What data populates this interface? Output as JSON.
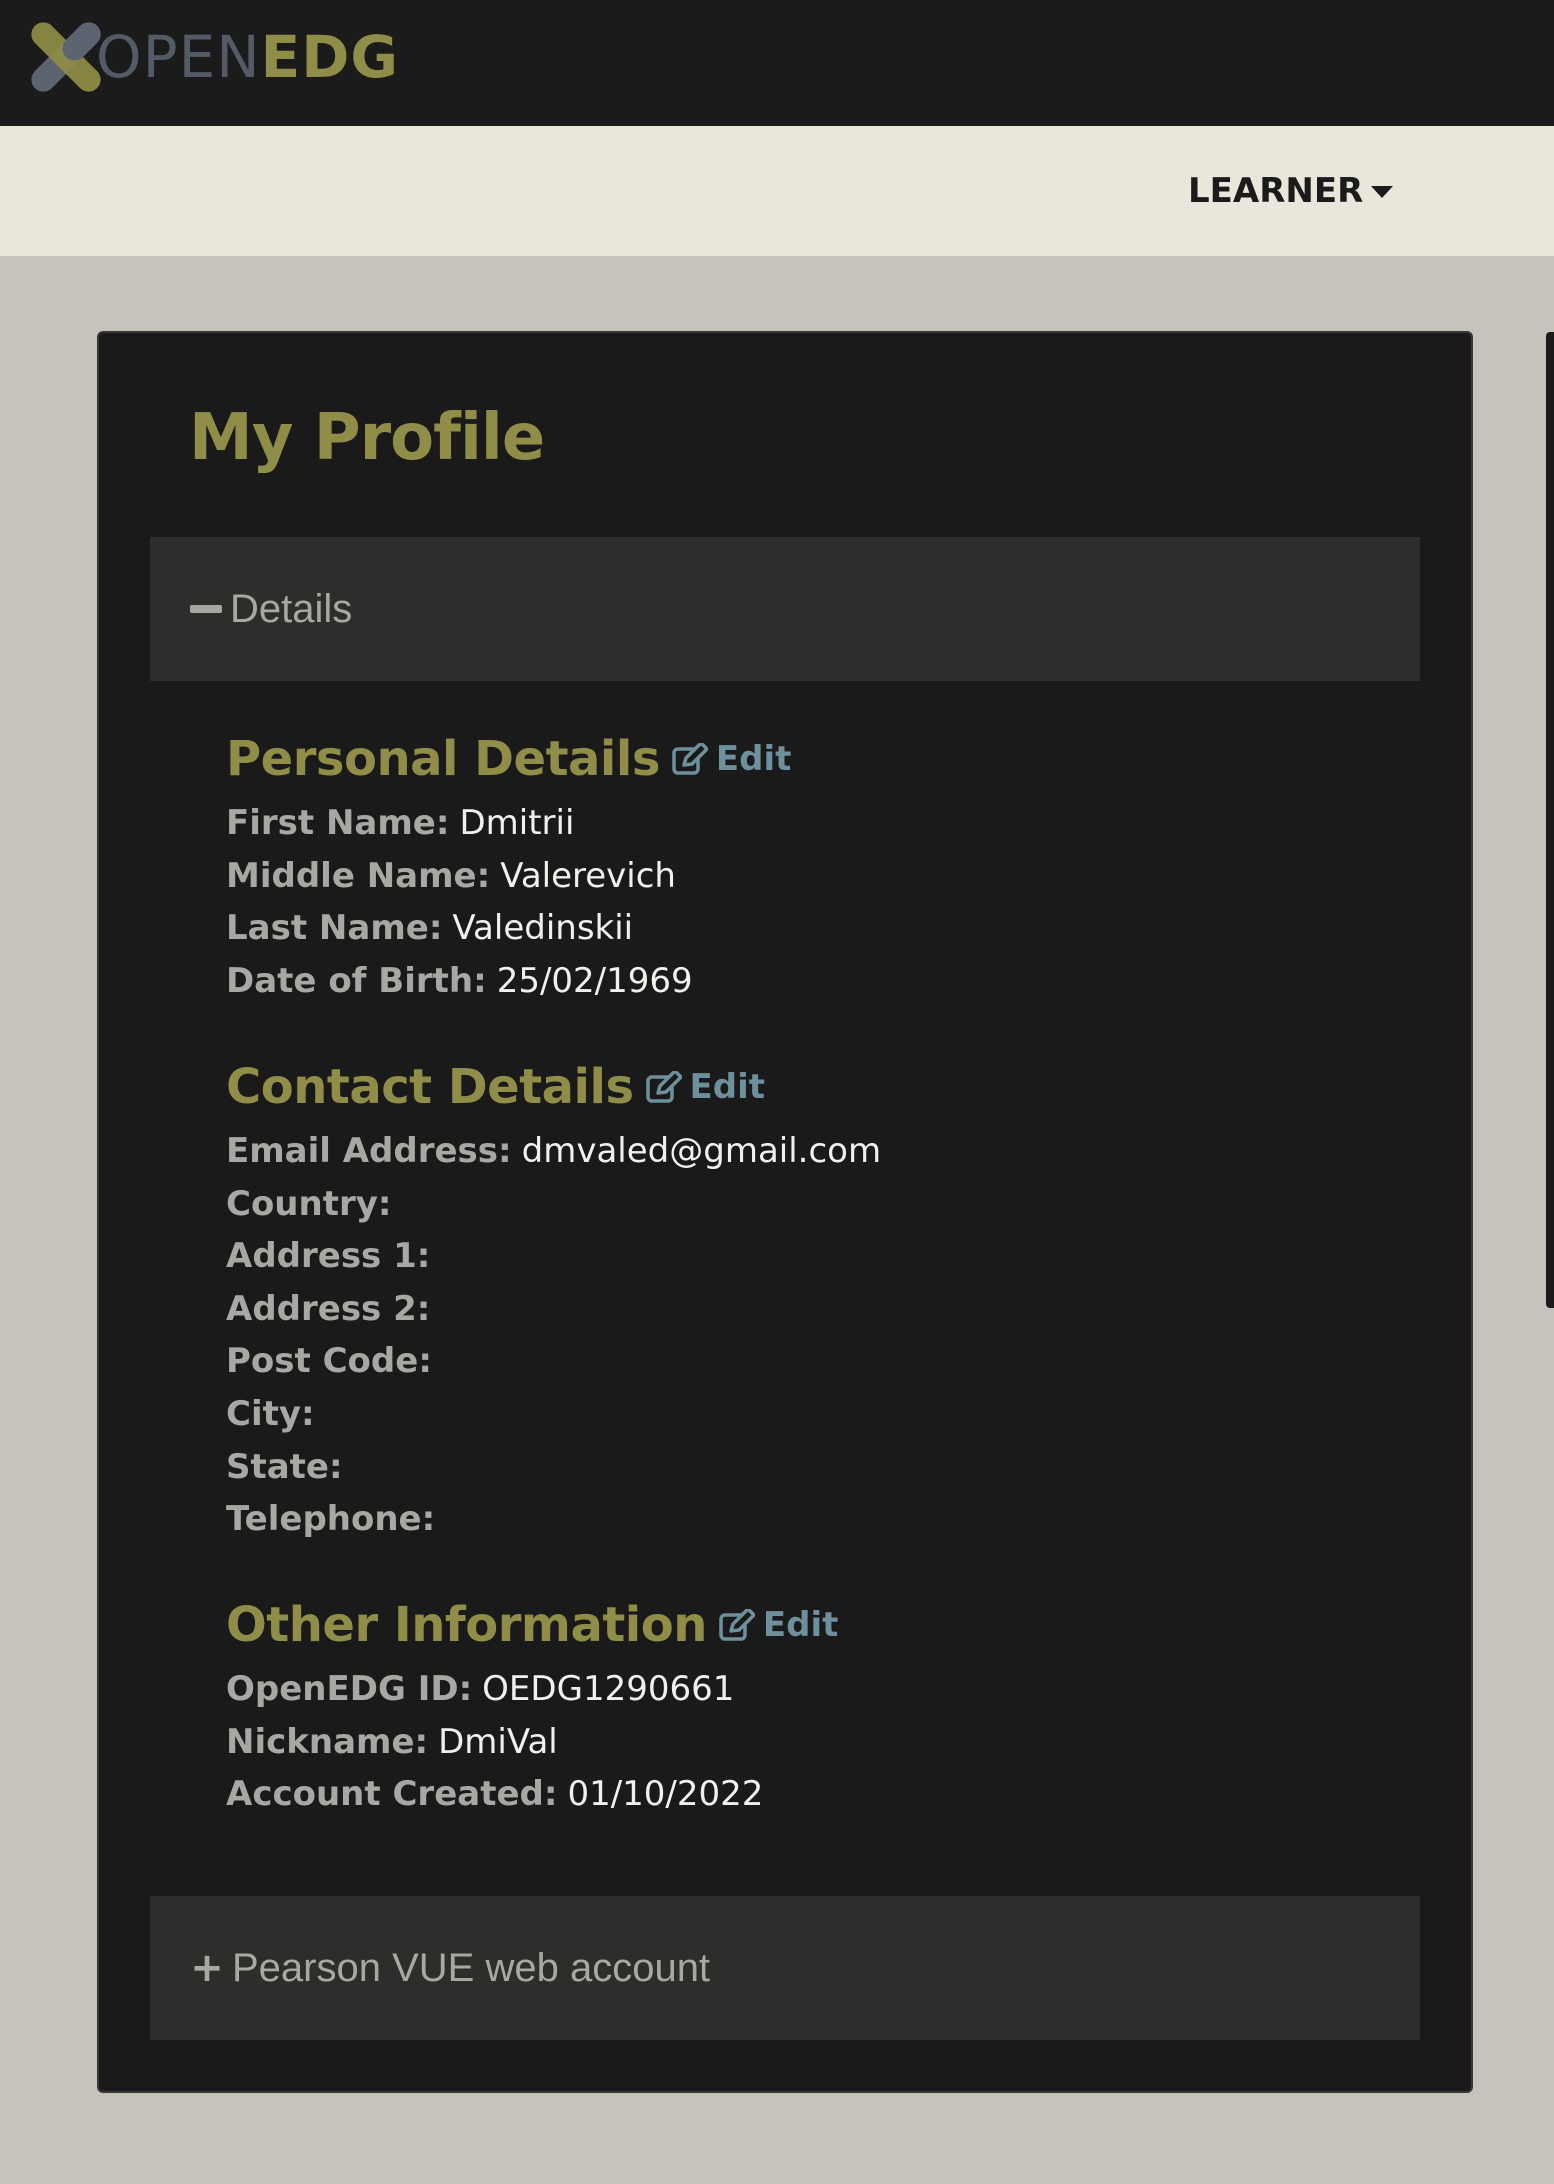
{
  "header": {
    "logo": {
      "word_open": "OPEN",
      "word_edg": "EDG"
    }
  },
  "nav": {
    "learner_label": "LEARNER"
  },
  "colors": {
    "olive": "#8f8d47",
    "link_blue": "#6e8f9c",
    "dark": "#1c1b1b",
    "beige": "#ebe6db"
  },
  "profile": {
    "title": "My Profile",
    "details_panel": {
      "symbol": "−",
      "title": "Details",
      "expanded": true
    },
    "personal": {
      "title": "Personal Details",
      "edit_label": "Edit",
      "rows": [
        {
          "label": "First Name:",
          "value": "Dmitrii"
        },
        {
          "label": "Middle Name:",
          "value": "Valerevich"
        },
        {
          "label": "Last Name:",
          "value": "Valedinskii"
        },
        {
          "label": "Date of Birth:",
          "value": "25/02/1969"
        }
      ]
    },
    "contact": {
      "title": "Contact Details",
      "edit_label": "Edit",
      "rows": [
        {
          "label": "Email Address:",
          "value": "dmvaled@gmail.com"
        },
        {
          "label": "Country:",
          "value": ""
        },
        {
          "label": "Address 1:",
          "value": ""
        },
        {
          "label": "Address 2:",
          "value": ""
        },
        {
          "label": "Post Code:",
          "value": ""
        },
        {
          "label": "City:",
          "value": ""
        },
        {
          "label": "State:",
          "value": ""
        },
        {
          "label": "Telephone:",
          "value": ""
        }
      ]
    },
    "other": {
      "title": "Other Information",
      "edit_label": "Edit",
      "rows": [
        {
          "label": "OpenEDG ID:",
          "value": "OEDG1290661"
        },
        {
          "label": "Nickname:",
          "value": "DmiVal"
        },
        {
          "label": "Account Created:",
          "value": "01/10/2022"
        }
      ]
    },
    "pearson_panel": {
      "symbol": "+",
      "title": "Pearson VUE web account",
      "expanded": false
    }
  }
}
